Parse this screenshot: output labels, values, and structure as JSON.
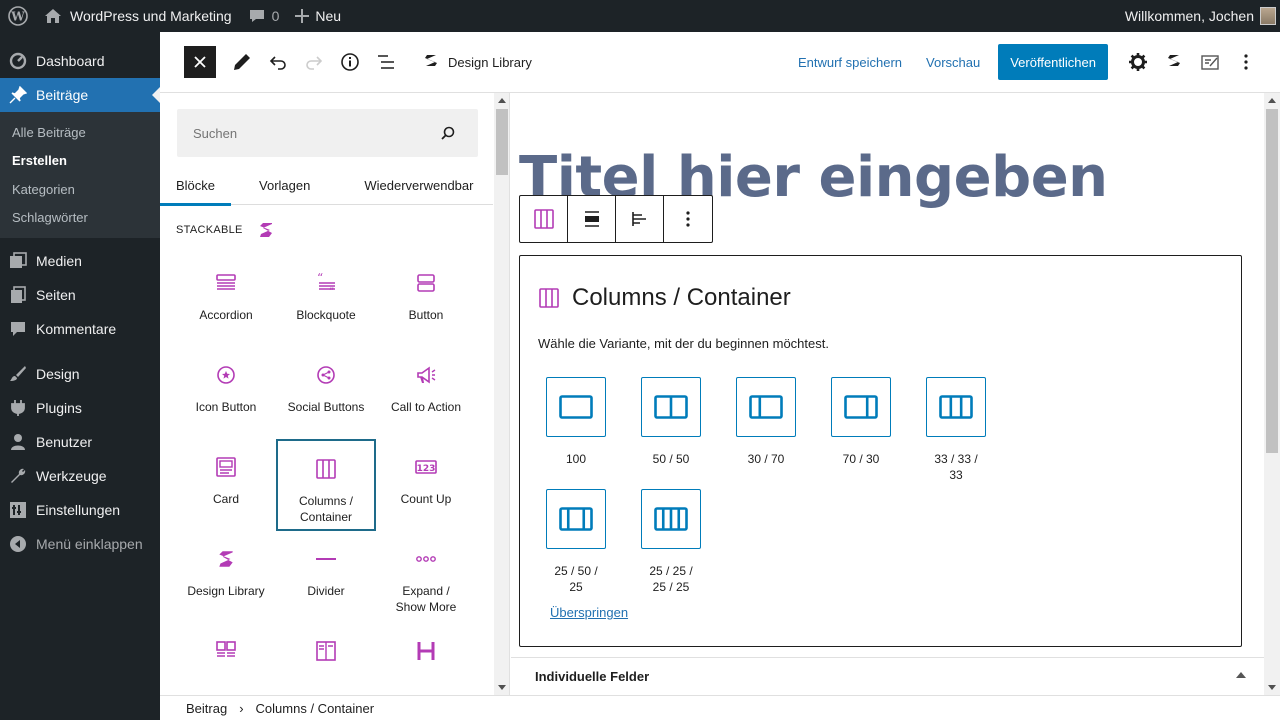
{
  "admin_bar": {
    "site_name": "WordPress und Marketing",
    "comments_count": "0",
    "new_label": "Neu",
    "greeting": "Willkommen, Jochen"
  },
  "sidebar": {
    "items": [
      {
        "label": "Dashboard",
        "icon": "dashboard-icon"
      },
      {
        "label": "Beiträge",
        "icon": "pin-icon",
        "active": true
      },
      {
        "label": "Medien",
        "icon": "media-icon"
      },
      {
        "label": "Seiten",
        "icon": "pages-icon"
      },
      {
        "label": "Kommentare",
        "icon": "comment-icon"
      },
      {
        "label": "Design",
        "icon": "brush-icon"
      },
      {
        "label": "Plugins",
        "icon": "plugin-icon"
      },
      {
        "label": "Benutzer",
        "icon": "user-icon"
      },
      {
        "label": "Werkzeuge",
        "icon": "wrench-icon"
      },
      {
        "label": "Einstellungen",
        "icon": "settings-icon"
      },
      {
        "label": "Menü einklappen",
        "icon": "collapse-icon"
      }
    ],
    "submenu": [
      "Alle Beiträge",
      "Erstellen",
      "Kategorien",
      "Schlagwörter"
    ]
  },
  "header": {
    "design_library": "Design Library",
    "save_draft": "Entwurf speichern",
    "preview": "Vorschau",
    "publish": "Veröffentlichen"
  },
  "inserter": {
    "search_placeholder": "Suchen",
    "tabs": [
      "Blöcke",
      "Vorlagen",
      "Wiederverwendbar"
    ],
    "category": "Stackable",
    "blocks": [
      {
        "label": "Accordion",
        "icon": "accordion-icon"
      },
      {
        "label": "Blockquote",
        "icon": "blockquote-icon"
      },
      {
        "label": "Button",
        "icon": "button-icon"
      },
      {
        "label": "Icon Button",
        "icon": "icon-button-icon"
      },
      {
        "label": "Social Buttons",
        "icon": "share-icon"
      },
      {
        "label": "Call to Action",
        "icon": "megaphone-icon"
      },
      {
        "label": "Card",
        "icon": "card-icon"
      },
      {
        "label": "Columns / Container",
        "icon": "columns-icon",
        "selected": true
      },
      {
        "label": "Count Up",
        "icon": "count-up-icon"
      },
      {
        "label": "Design Library",
        "icon": "stackable-logo-icon"
      },
      {
        "label": "Divider",
        "icon": "divider-icon"
      },
      {
        "label": "Expand / Show More",
        "icon": "ellipsis-icon"
      }
    ],
    "partial_row_icons": [
      "feature-grid-icon",
      "feature-icon",
      "heading-icon"
    ]
  },
  "canvas": {
    "title": "Titel hier eingeben",
    "placeholder_title": "Columns / Container",
    "instructions": "Wähle die Variante, mit der du beginnen möchtest.",
    "variants": [
      {
        "label": "100",
        "cols": [
          1
        ]
      },
      {
        "label": "50 / 50",
        "cols": [
          1,
          1
        ]
      },
      {
        "label": "30 / 70",
        "cols": [
          3,
          7
        ]
      },
      {
        "label": "70 / 30",
        "cols": [
          7,
          3
        ]
      },
      {
        "label": "33 / 33 / 33",
        "cols": [
          1,
          1,
          1
        ]
      },
      {
        "label": "25 / 50 / 25",
        "cols": [
          1,
          2,
          1
        ]
      },
      {
        "label": "25 / 25 / 25 / 25",
        "cols": [
          1,
          1,
          1,
          1
        ]
      }
    ],
    "skip": "Überspringen",
    "panel": "Individuelle Felder"
  },
  "breadcrumb": [
    "Beitrag",
    "Columns / Container"
  ],
  "colors": {
    "admin_dark": "#1d2327",
    "accent_blue": "#2271b1",
    "publish_blue": "#007cba",
    "stackable_magenta": "#b33bb5",
    "title_gray": "#5b6a8a"
  }
}
